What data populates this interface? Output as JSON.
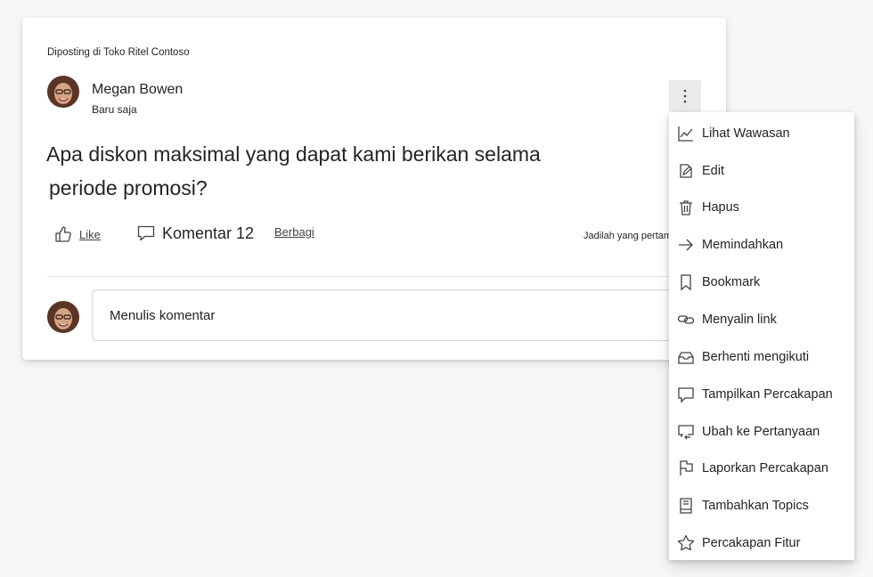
{
  "post": {
    "posted_in": "Diposting di Toko Ritel Contoso",
    "author": "Megan Bowen",
    "time": "Baru saja",
    "question_line1": "Apa diskon maksimal yang dapat kami berikan selama",
    "question_line2": "periode promosi?",
    "more_icon": "more-vertical-icon"
  },
  "actions": {
    "like_label": "Like",
    "comment_label": "Komentar 12",
    "share_label": "Berbagi",
    "first_hint": "Jadilah yang pertama sakit"
  },
  "comment": {
    "placeholder": "Menulis komentar"
  },
  "menu": {
    "items": [
      {
        "label": "Lihat Wawasan",
        "icon": "insights-chart-icon"
      },
      {
        "label": "Edit",
        "icon": "edit-icon"
      },
      {
        "label": "Hapus",
        "icon": "trash-icon"
      },
      {
        "label": "Memindahkan",
        "icon": "move-arrow-icon"
      },
      {
        "label": "Bookmark",
        "icon": "bookmark-icon"
      },
      {
        "label": "Menyalin link",
        "icon": "link-icon"
      },
      {
        "label": "Berhenti mengikuti",
        "icon": "unfollow-inbox-icon"
      },
      {
        "label": "Tampilkan Percakapan",
        "icon": "conversation-icon"
      },
      {
        "label": "Ubah ke Pertanyaan",
        "icon": "change-to-question-icon"
      },
      {
        "label": "Laporkan Percakapan",
        "icon": "flag-icon"
      },
      {
        "label": "Tambahkan Topics",
        "icon": "topics-book-icon"
      },
      {
        "label": "Percakapan Fitur",
        "icon": "star-icon"
      }
    ]
  },
  "colors": {
    "background": "#f8f7f6",
    "card": "#ffffff",
    "text": "#242424",
    "more_button_bg": "#ebebeb"
  }
}
